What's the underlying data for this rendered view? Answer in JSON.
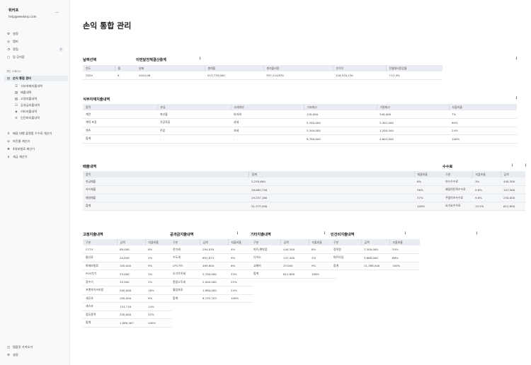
{
  "sidebar": {
    "name": "위커프",
    "email": "help@weekerp.com",
    "section": "개인 스페이스",
    "top_items": [
      {
        "label": "설정",
        "icon": "⚙"
      },
      {
        "label": "멤버",
        "icon": "◎"
      },
      {
        "label": "알림",
        "icon": "◔",
        "badge": "7"
      },
      {
        "label": "팀 공지함",
        "icon": "▢"
      }
    ],
    "active_label": "손익 통합 관리",
    "sub_items": [
      "식부자재지출내역",
      "매출내역",
      "고정지출내역",
      "공과금지출내역",
      "기타지출내역",
      "인건비지출내역"
    ],
    "other_items": [
      "배달 대행 플랫폼 수수료 계산기",
      "마진율 계산기",
      "4대보험료 계산기",
      "세금 계산기"
    ],
    "bottom_items": [
      "템플릿 가져오기",
      "설정"
    ]
  },
  "page": {
    "title": "손익 통합 관리"
  },
  "date_select": {
    "title": "날짜선택",
    "headers": [
      "연도",
      "월"
    ],
    "rows": [
      [
        "2024",
        "6"
      ]
    ]
  },
  "settlement": {
    "title": "이번달전체결산총계",
    "headers": [
      "날짜",
      "총매출",
      "총지출비용",
      "순이익",
      "전월대비증감율"
    ],
    "rows": [
      [
        "2024-06",
        "513,735,000",
        "397,214,870",
        "116,520,130",
        "+12.4%"
      ]
    ]
  },
  "food": {
    "title": "식부자재지출내역",
    "headers": [
      "품목",
      "분류",
      "과세여부",
      "기초재고",
      "기말재고",
      "지출비율"
    ],
    "rows": [
      [
        "계란",
        "축산물",
        "비과세",
        "120,000",
        "340,000",
        "7%"
      ],
      [
        "계육 포장",
        "가공육류",
        "과세",
        "5,340,000",
        "3,402,000",
        "69%"
      ],
      [
        "맥주",
        "주류",
        "과세",
        "3,300,000",
        "1,200,000",
        "24%"
      ],
      [
        "합계",
        "-",
        "-",
        "8,760,000",
        "4,602,000",
        "100%"
      ]
    ]
  },
  "sales": {
    "title": "매출내역",
    "headers": [
      "품목",
      "합계",
      "매출비율"
    ],
    "rows": [
      [
        "현금매출",
        "3,230,600",
        "6%"
      ],
      [
        "카드매출",
        "28,885,740",
        "56%"
      ],
      [
        "배달매출",
        "19,257,160",
        "37%"
      ],
      [
        "합계",
        "51,373,500",
        "100%"
      ]
    ]
  },
  "fee": {
    "title": "수수료",
    "headers": [
      "구분",
      "지출비율",
      "금액"
    ],
    "rows": [
      [
        "카드수수료",
        "3%",
        "440,300"
      ],
      [
        "배달의민족수수료",
        "9.8%",
        "147,500"
      ],
      [
        "쿠팡이츠수수료",
        "9.6%",
        "250,000"
      ],
      [
        "요기요수수료",
        "12.5%",
        "612,800"
      ]
    ]
  },
  "fixed": {
    "title": "고정지출내역",
    "headers": [
      "구분",
      "금액",
      "지출비율"
    ],
    "rows": [
      [
        "CCTV",
        "88,000",
        "8%"
      ],
      [
        "통신료",
        "20,849",
        "2%"
      ],
      [
        "화재보험료",
        "100,000",
        "9%"
      ],
      [
        "POS기기",
        "33,000",
        "3%"
      ],
      [
        "정수기",
        "34,900",
        "3%"
      ],
      [
        "프랜차이즈비용",
        "200,000",
        "18%"
      ],
      [
        "세무사",
        "100,000",
        "9%"
      ],
      [
        "세스코",
        "153,718",
        "14%"
      ],
      [
        "정도용역",
        "350,000",
        "32%"
      ],
      [
        "합계",
        "1,086,467",
        "100%"
      ]
    ]
  },
  "utility": {
    "title": "공과금지출내역",
    "headers": [
      "구분",
      "금액",
      "지출비율"
    ],
    "rows": [
      [
        "전기세",
        "294,030",
        "4%"
      ],
      [
        "수도세",
        "691,873",
        "9%"
      ],
      [
        "LPG가스",
        "469,800",
        "6%"
      ],
      [
        "부가가치세",
        "2,700,000",
        "33%"
      ],
      [
        "종합소득세",
        "2,000,000",
        "25%"
      ],
      [
        "월임차료",
        "1,980,000",
        "24%"
      ],
      [
        "합계",
        "8,135,703",
        "100%"
      ]
    ]
  },
  "etc": {
    "title": "기타지출내역",
    "headers": [
      "구분",
      "금액",
      "지출비율"
    ],
    "rows": [
      [
        "마트/편의점",
        "440,300",
        "8%"
      ],
      [
        "다이소",
        "147,500",
        "2%"
      ],
      [
        "교통비",
        "25,000",
        "9%"
      ],
      [
        "합계",
        "612,800",
        "100%"
      ]
    ]
  },
  "labor": {
    "title": "인건비지출내역",
    "headers": [
      "구분",
      "금액",
      "지출비율"
    ],
    "rows": [
      [
        "정직원",
        "7,500,000",
        "34%"
      ],
      [
        "파트타임",
        "3,888,000",
        "66%"
      ],
      [
        "합계",
        "11,388,000",
        "100%"
      ]
    ]
  },
  "colors": {
    "header_bg": "#e9ecf0",
    "sidebar_bg": "#f7f9fb",
    "active_bg": "#e9edf2"
  }
}
